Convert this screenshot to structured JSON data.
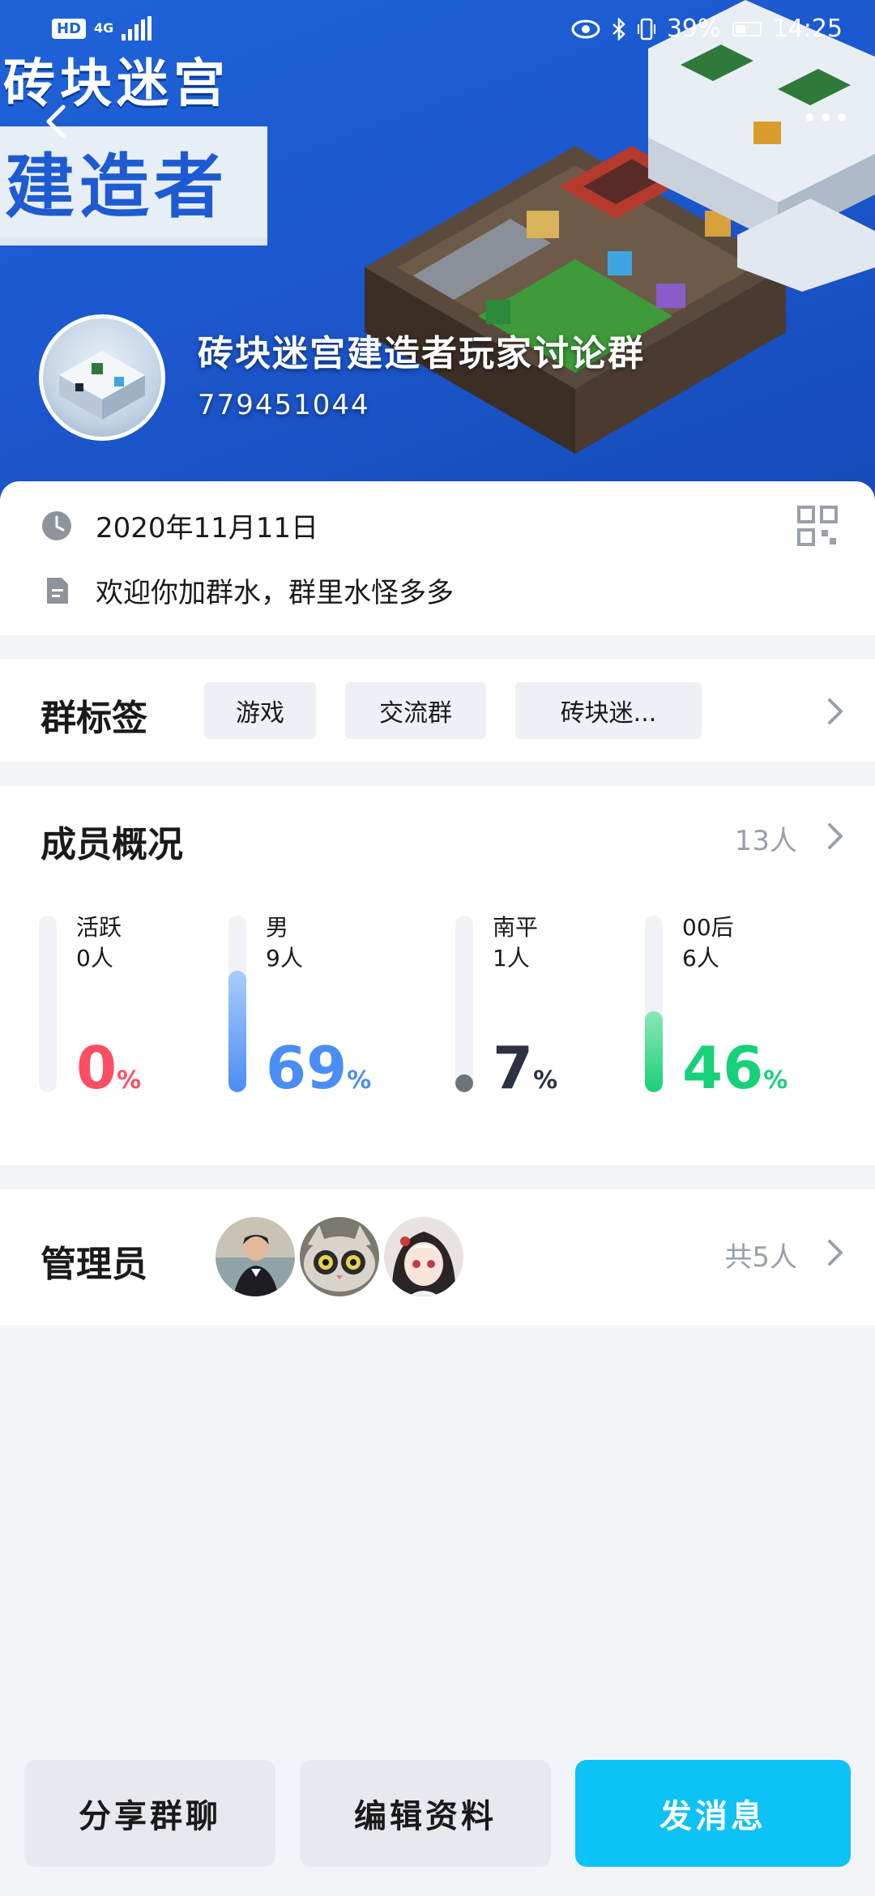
{
  "status_bar": {
    "network_badge": "HD",
    "signal_text": "4G",
    "battery": "39%",
    "time": "14:25"
  },
  "banner": {
    "game_title_line1": "砖块迷宫",
    "game_title_line2": "建造者"
  },
  "group": {
    "name": "砖块迷宫建造者玩家讨论群",
    "id": "779451044",
    "created_date": "2020年11月11日",
    "intro": "欢迎你加群水，群里水怪多多"
  },
  "tags": {
    "title": "群标签",
    "items": [
      "游戏",
      "交流群",
      "砖块迷..."
    ]
  },
  "members": {
    "title": "成员概况",
    "count": "13人",
    "stats": [
      {
        "label": "活跃",
        "sub": "0人",
        "percent": 0,
        "color": "#ff4d63"
      },
      {
        "label": "男",
        "sub": "9人",
        "percent": 69,
        "color": "#4a8ef5"
      },
      {
        "label": "南平",
        "sub": "1人",
        "percent": 7,
        "color": "#2c3345"
      },
      {
        "label": "00后",
        "sub": "6人",
        "percent": 46,
        "color": "#19d07a"
      }
    ],
    "percent_sign": "%"
  },
  "admins": {
    "title": "管理员",
    "total": "共5人",
    "avatars": [
      "admin-avatar-man",
      "admin-avatar-cat",
      "admin-avatar-anime-girl"
    ]
  },
  "actions": {
    "share": "分享群聊",
    "edit": "编辑资料",
    "message": "发消息"
  },
  "colors": {
    "primary": "#0cc2f7",
    "banner_blue": "#1f63d8",
    "muted": "#9aa0aa"
  }
}
